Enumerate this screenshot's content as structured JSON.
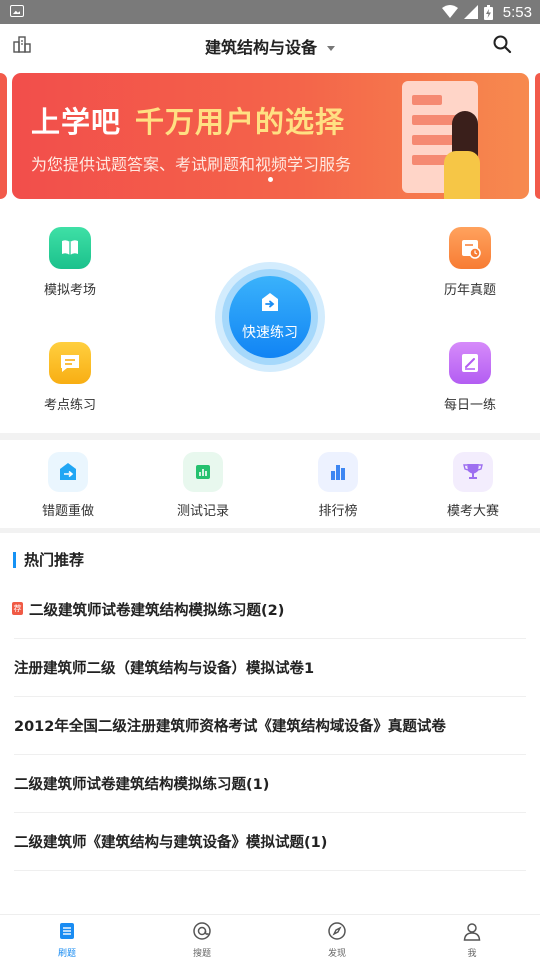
{
  "status_bar": {
    "time": "5:53"
  },
  "header": {
    "title": "建筑结构与设备"
  },
  "banner": {
    "title_part1": "上学吧",
    "title_part2": "千万用户的选择",
    "subtitle": "为您提供试题答案、考试刷题和视频学习服务"
  },
  "quick_entries": {
    "mock_exam": "模拟考场",
    "past_papers": "历年真题",
    "quick_practice": "快速练习",
    "point_practice": "考点练习",
    "daily_practice": "每日一练"
  },
  "tools": {
    "wrong_redo": "错题重做",
    "test_records": "测试记录",
    "ranking": "排行榜",
    "mock_contest": "模考大赛"
  },
  "hot": {
    "title": "热门推荐",
    "items": [
      {
        "text": "二级建筑师试卷建筑结构模拟练习题(2)",
        "tag": "荐"
      },
      {
        "text": "注册建筑师二级（建筑结构与设备）模拟试卷1"
      },
      {
        "text": "2012年全国二级注册建筑师资格考试《建筑结构域设备》真题试卷"
      },
      {
        "text": "二级建筑师试卷建筑结构模拟练习题(1)"
      },
      {
        "text": "二级建筑师《建筑结构与建筑设备》模拟试题(1)"
      }
    ]
  },
  "tabs": [
    {
      "label": "刷题",
      "active": true
    },
    {
      "label": "搜题"
    },
    {
      "label": "发现"
    },
    {
      "label": "我"
    }
  ],
  "colors": {
    "accent": "#1a8cf2",
    "banner": "#f24e4b"
  }
}
